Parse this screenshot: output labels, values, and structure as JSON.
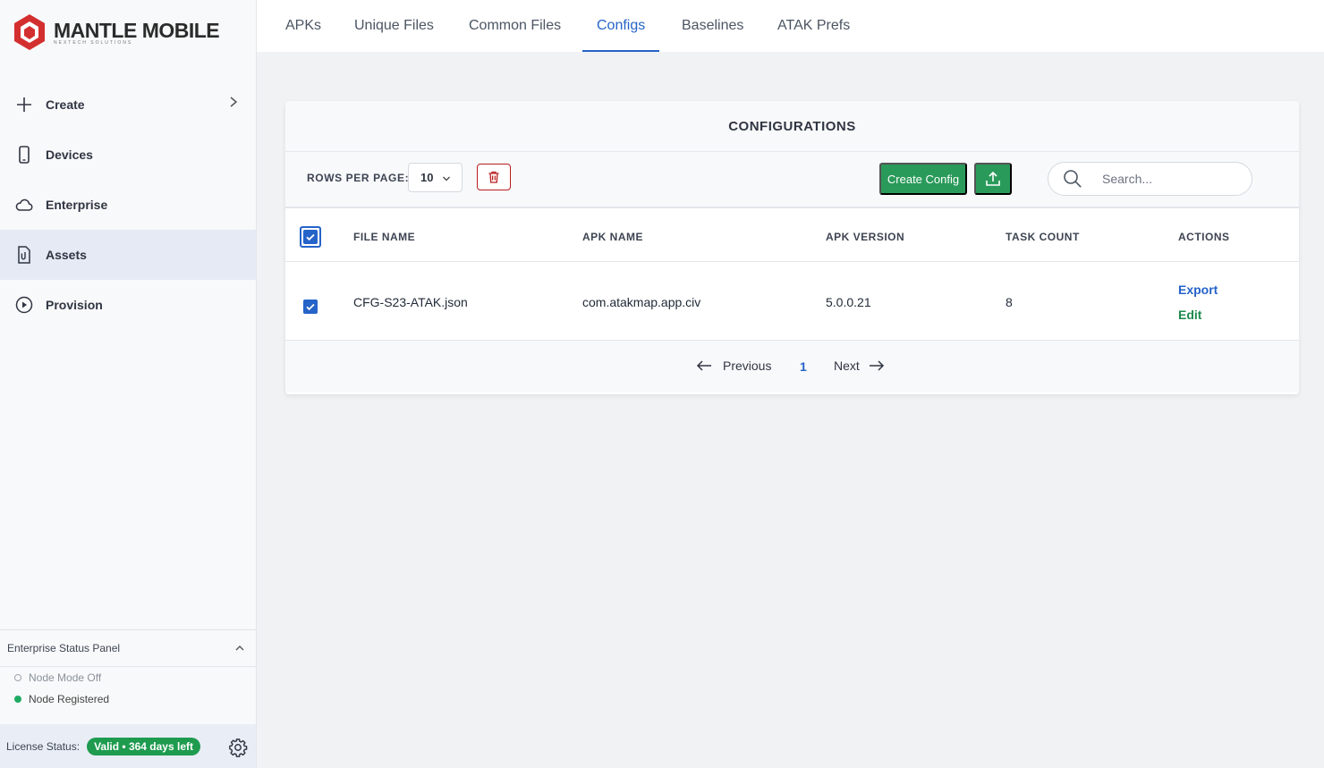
{
  "brand": {
    "name": "MANTLE MOBILE",
    "tagline": "NEXTECH SOLUTIONS",
    "accent": "#d32f2f"
  },
  "sidebar": {
    "items": [
      {
        "label": "Create",
        "icon": "plus-icon",
        "has_chevron": true,
        "active": false
      },
      {
        "label": "Devices",
        "icon": "phone-icon",
        "active": false
      },
      {
        "label": "Enterprise",
        "icon": "cloud-icon",
        "active": false
      },
      {
        "label": "Assets",
        "icon": "file-attachment-icon",
        "active": true
      },
      {
        "label": "Provision",
        "icon": "play-circle-icon",
        "active": false
      }
    ],
    "status_panel": {
      "title": "Enterprise Status Panel",
      "rows": [
        {
          "label": "Node Mode Off",
          "state": "off"
        },
        {
          "label": "Node Registered",
          "state": "on",
          "color": "#1faa63"
        }
      ]
    },
    "license": {
      "label": "License Status:",
      "badge": "Valid • 364 days left",
      "badge_color": "#1e9b4f"
    }
  },
  "tabs": [
    {
      "label": "APKs",
      "active": false
    },
    {
      "label": "Unique Files",
      "active": false
    },
    {
      "label": "Common Files",
      "active": false
    },
    {
      "label": "Configs",
      "active": true
    },
    {
      "label": "Baselines",
      "active": false
    },
    {
      "label": "ATAK Prefs",
      "active": false
    }
  ],
  "card": {
    "title": "CONFIGURATIONS",
    "rows_per_page_label": "ROWS PER PAGE:",
    "rows_per_page_value": "10",
    "create_button": "Create Config",
    "search_placeholder": "Search...",
    "columns": [
      "FILE NAME",
      "APK NAME",
      "APK VERSION",
      "TASK COUNT",
      "ACTIONS"
    ],
    "rows": [
      {
        "checked": true,
        "file_name": "CFG-S23-ATAK.json",
        "apk_name": "com.atakmap.app.civ",
        "apk_version": "5.0.0.21",
        "task_count": "8",
        "actions": [
          "Export",
          "Edit"
        ]
      }
    ],
    "pagination": {
      "previous": "Previous",
      "current_page": "1",
      "next": "Next"
    }
  },
  "colors": {
    "primary": "#2563c8",
    "success": "#2a9a5a",
    "danger": "#b91c1c"
  }
}
